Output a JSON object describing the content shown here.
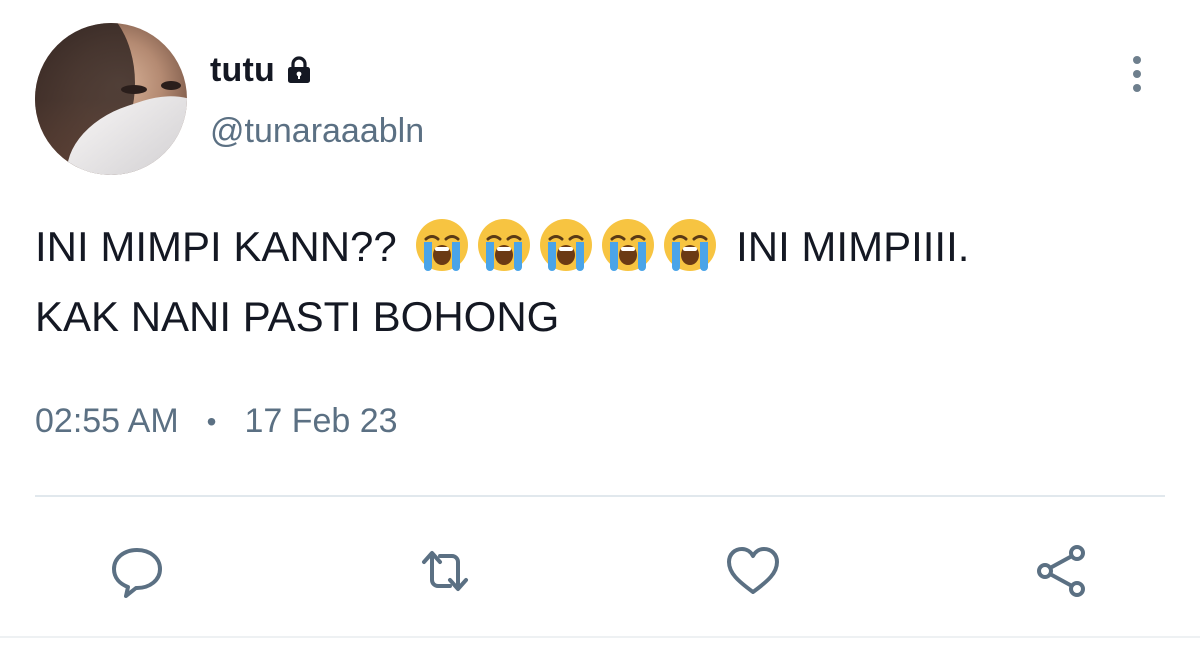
{
  "user": {
    "display_name": "tutu",
    "handle": "@tunaraaabln",
    "protected_icon": "lock-icon",
    "avatar": "profile-photo"
  },
  "tweet": {
    "text_part1": "INI MIMPI KANN??",
    "emoji": "loudly-crying-face",
    "emoji_count": 5,
    "text_part2": "INI MIMPIIII.",
    "text_line2": "KAK NANI PASTI BOHONG",
    "time": "02:55 AM",
    "separator": "•",
    "date": "17 Feb 23"
  },
  "actions": {
    "reply_icon": "reply-icon",
    "retweet_icon": "retweet-icon",
    "like_icon": "heart-icon",
    "share_icon": "share-icon"
  },
  "colors": {
    "text": "#141823",
    "secondary": "#5b7083",
    "divider": "#e1e8ed",
    "emoji_face": "#f7c441",
    "emoji_tears": "#4aa4e8"
  }
}
